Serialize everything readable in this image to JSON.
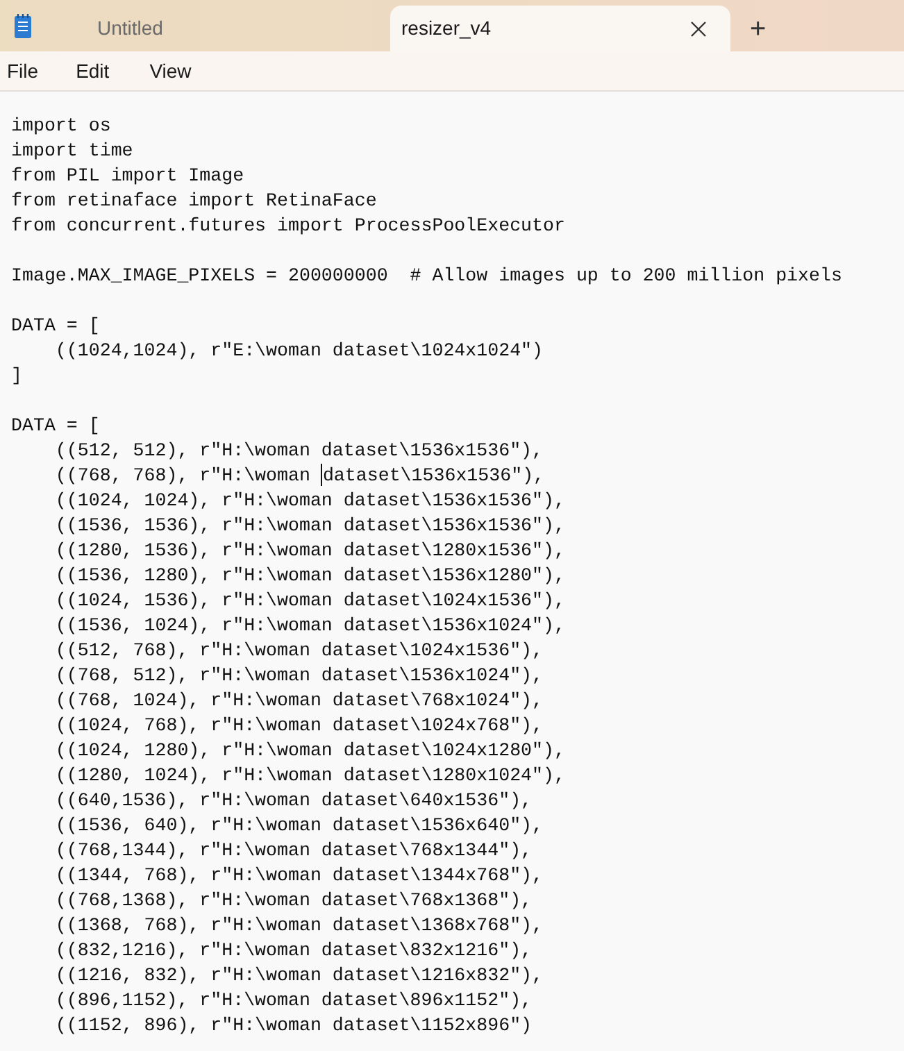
{
  "tabs": [
    {
      "title": "Untitled",
      "selected": false
    },
    {
      "title": "resizer_v4",
      "selected": true
    }
  ],
  "new_tab": "+",
  "menu": [
    "File",
    "Edit",
    "View"
  ],
  "editor": {
    "blocks": [
      {
        "lines": [
          {
            "text": "import os"
          },
          {
            "text": "import time"
          },
          {
            "text": "from PIL import Image"
          },
          {
            "text": "from retinaface import RetinaFace"
          },
          {
            "text": "from concurrent.futures import ProcessPoolExecutor"
          }
        ]
      },
      {
        "lines": [
          {
            "text": "Image.MAX_IMAGE_PIXELS = 200000000  # Allow images up to 200 million pixels"
          }
        ]
      },
      {
        "lines": [
          {
            "text": "DATA = ["
          },
          {
            "text": "    ((1024,1024), r\"E:\\woman dataset\\1024x1024\")"
          },
          {
            "text": "]"
          }
        ]
      },
      {
        "lines": [
          {
            "text": "DATA = ["
          },
          {
            "text": "    ((512, 512), r\"H:\\woman dataset\\1536x1536\"),"
          },
          {
            "text": "    ((768, 768), r\"H:\\woman ",
            "after_caret": "dataset\\1536x1536\"),",
            "caret": true
          },
          {
            "text": "    ((1024, 1024), r\"H:\\woman dataset\\1536x1536\"),"
          },
          {
            "text": "    ((1536, 1536), r\"H:\\woman dataset\\1536x1536\"),"
          },
          {
            "text": "    ((1280, 1536), r\"H:\\woman dataset\\1280x1536\"),"
          },
          {
            "text": "    ((1536, 1280), r\"H:\\woman dataset\\1536x1280\"),"
          },
          {
            "text": "    ((1024, 1536), r\"H:\\woman dataset\\1024x1536\"),"
          },
          {
            "text": "    ((1536, 1024), r\"H:\\woman dataset\\1536x1024\"),"
          },
          {
            "text": "    ((512, 768), r\"H:\\woman dataset\\1024x1536\"),"
          },
          {
            "text": "    ((768, 512), r\"H:\\woman dataset\\1536x1024\"),"
          },
          {
            "text": "    ((768, 1024), r\"H:\\woman dataset\\768x1024\"),"
          },
          {
            "text": "    ((1024, 768), r\"H:\\woman dataset\\1024x768\"),"
          },
          {
            "text": "    ((1024, 1280), r\"H:\\woman dataset\\1024x1280\"),"
          },
          {
            "text": "    ((1280, 1024), r\"H:\\woman dataset\\1280x1024\"),"
          },
          {
            "text": "    ((640,1536), r\"H:\\woman dataset\\640x1536\"),"
          },
          {
            "text": "    ((1536, 640), r\"H:\\woman dataset\\1536x640\"),"
          },
          {
            "text": "    ((768,1344), r\"H:\\woman dataset\\768x1344\"),"
          },
          {
            "text": "    ((1344, 768), r\"H:\\woman dataset\\1344x768\"),"
          },
          {
            "text": "    ((768,1368), r\"H:\\woman dataset\\768x1368\"),"
          },
          {
            "text": "    ((1368, 768), r\"H:\\woman dataset\\1368x768\"),"
          },
          {
            "text": "    ((832,1216), r\"H:\\woman dataset\\832x1216\"),"
          },
          {
            "text": "    ((1216, 832), r\"H:\\woman dataset\\1216x832\"),"
          },
          {
            "text": "    ((896,1152), r\"H:\\woman dataset\\896x1152\"),"
          },
          {
            "text": "    ((1152, 896), r\"H:\\woman dataset\\1152x896\")"
          }
        ]
      }
    ]
  }
}
